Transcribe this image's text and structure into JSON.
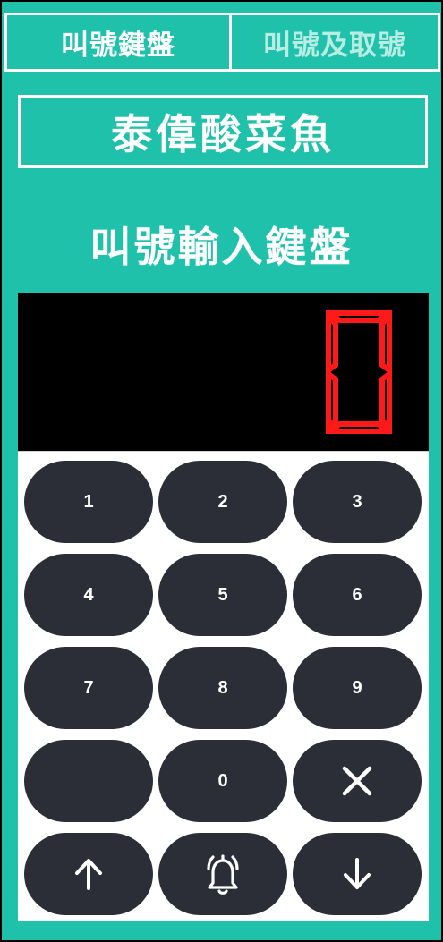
{
  "tabs": [
    {
      "label": "叫號鍵盤",
      "active": true
    },
    {
      "label": "叫號及取號",
      "active": false
    }
  ],
  "store_name": "泰偉酸菜魚",
  "keypad_title": "叫號輸入鍵盤",
  "display": {
    "value": "0",
    "color": "#ff1a1a"
  },
  "keys": {
    "k1": "1",
    "k2": "2",
    "k3": "3",
    "k4": "4",
    "k5": "5",
    "k6": "6",
    "k7": "7",
    "k8": "8",
    "k9": "9",
    "k0": "0",
    "clear_icon": "x-icon",
    "up_icon": "arrow-up-icon",
    "bell_icon": "bell-icon",
    "down_icon": "arrow-down-icon"
  },
  "colors": {
    "accent": "#1fc1ab",
    "key": "#2b2e36"
  }
}
